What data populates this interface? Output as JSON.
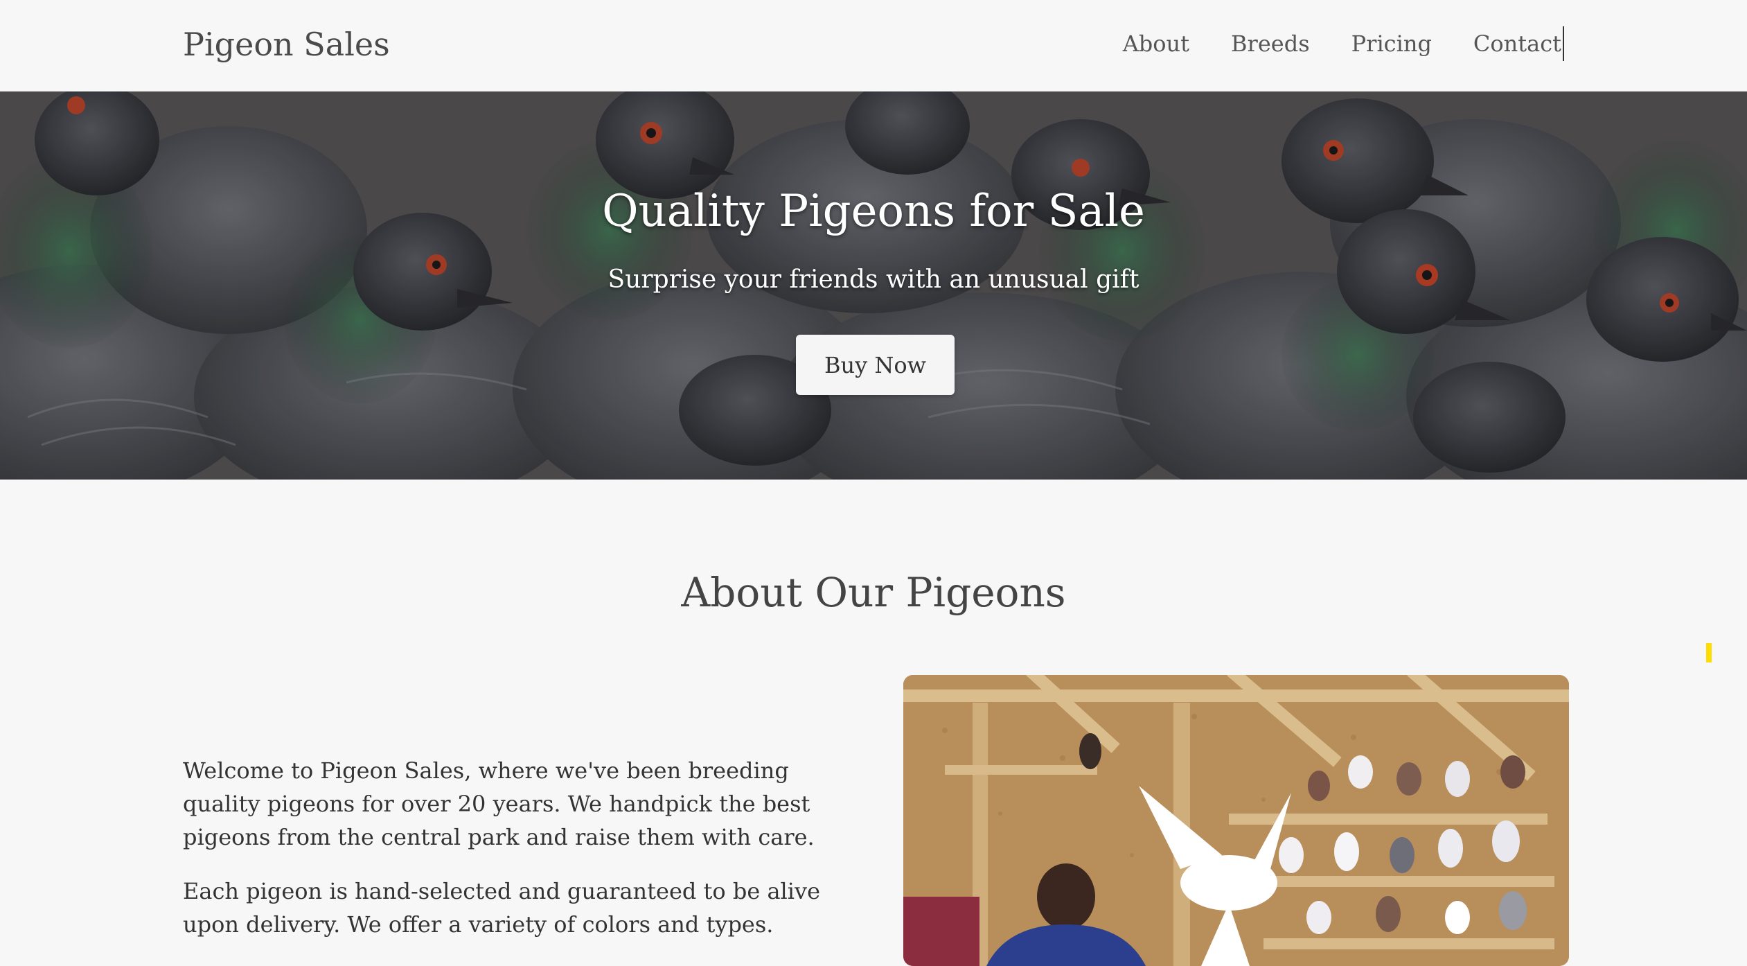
{
  "header": {
    "brand": "Pigeon Sales",
    "nav": [
      {
        "label": "About"
      },
      {
        "label": "Breeds"
      },
      {
        "label": "Pricing"
      },
      {
        "label": "Contact"
      }
    ]
  },
  "hero": {
    "title": "Quality Pigeons for Sale",
    "subtitle": "Surprise your friends with an unusual gift",
    "button_label": "Buy Now"
  },
  "about": {
    "title": "About Our Pigeons",
    "paragraphs": [
      "Welcome to Pigeon Sales, where we've been breeding quality pigeons for over 20 years. We handpick the best pigeons from the central park and raise them with care.",
      "Each pigeon is hand-selected and guaranteed to be alive upon delivery. We offer a variety of colors and types."
    ]
  },
  "colors": {
    "page_background": "#f7f7f7",
    "text": "#333333",
    "button_background": "#f5f5f5",
    "scroll_marker": "#ffdd00"
  }
}
